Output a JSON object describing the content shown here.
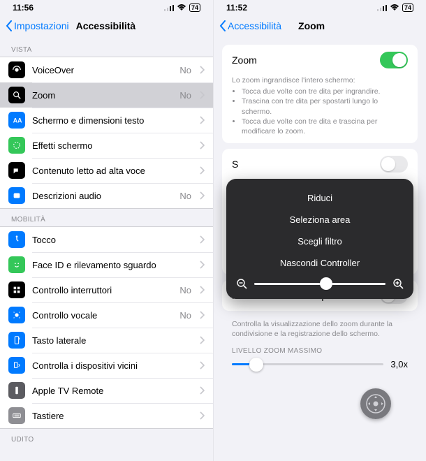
{
  "left": {
    "status": {
      "time": "11:56",
      "battery": "74"
    },
    "nav": {
      "back": "Impostazioni",
      "title": "Accessibilità"
    },
    "sections": {
      "vista": {
        "header": "VISTA",
        "items": [
          {
            "label": "VoiceOver",
            "value": "No",
            "icon": "voiceover",
            "bg": "#000"
          },
          {
            "label": "Zoom",
            "value": "No",
            "icon": "zoom",
            "bg": "#000",
            "selected": true
          },
          {
            "label": "Schermo e dimensioni testo",
            "value": "",
            "icon": "text-size",
            "bg": "#007aff"
          },
          {
            "label": "Effetti schermo",
            "value": "",
            "icon": "motion",
            "bg": "#34c759"
          },
          {
            "label": "Contenuto letto ad alta voce",
            "value": "",
            "icon": "speech",
            "bg": "#000"
          },
          {
            "label": "Descrizioni audio",
            "value": "No",
            "icon": "audio-desc",
            "bg": "#007aff"
          }
        ]
      },
      "mobilita": {
        "header": "MOBILITÀ",
        "items": [
          {
            "label": "Tocco",
            "value": "",
            "icon": "touch",
            "bg": "#007aff"
          },
          {
            "label": "Face ID e rilevamento sguardo",
            "value": "",
            "icon": "faceid",
            "bg": "#34c759"
          },
          {
            "label": "Controllo interruttori",
            "value": "No",
            "icon": "switch",
            "bg": "#000"
          },
          {
            "label": "Controllo vocale",
            "value": "No",
            "icon": "voice-ctrl",
            "bg": "#007aff"
          },
          {
            "label": "Tasto laterale",
            "value": "",
            "icon": "side-btn",
            "bg": "#007aff"
          },
          {
            "label": "Controlla i dispositivi vicini",
            "value": "",
            "icon": "nearby",
            "bg": "#007aff"
          },
          {
            "label": "Apple TV Remote",
            "value": "",
            "icon": "remote",
            "bg": "#5b5b60"
          },
          {
            "label": "Tastiere",
            "value": "",
            "icon": "keyboard",
            "bg": "#8e8e93"
          }
        ]
      },
      "udito": {
        "header": "UDITO"
      }
    }
  },
  "right": {
    "status": {
      "time": "11:52",
      "battery": "74"
    },
    "nav": {
      "back": "Accessibilità",
      "title": "Zoom"
    },
    "zoom_row": {
      "label": "Zoom",
      "on": true
    },
    "zoom_help": {
      "lead": "Lo zoom ingrandisce l'intero schermo:",
      "b1": "Tocca due volte con tre dita per ingrandire.",
      "b2": "Trascina con tre dita per spostarti lungo lo schermo.",
      "b3": "Tocca due volte con tre dita e trascina per modificare lo zoom."
    },
    "hidden_row_prefix": "S",
    "popover": {
      "i1": "Riduci",
      "i2": "Seleziona area",
      "i3": "Scegli filtro",
      "i4": "Nascondi Controller"
    },
    "mirror": {
      "label": "Mostra durante la duplicazione",
      "on": false
    },
    "mirror_note": "Controlla la visualizzazione dello zoom durante la condivisione e la registrazione dello schermo.",
    "max": {
      "header": "LIVELLO ZOOM MASSIMO",
      "value": "3,0x",
      "pct": 16
    }
  }
}
